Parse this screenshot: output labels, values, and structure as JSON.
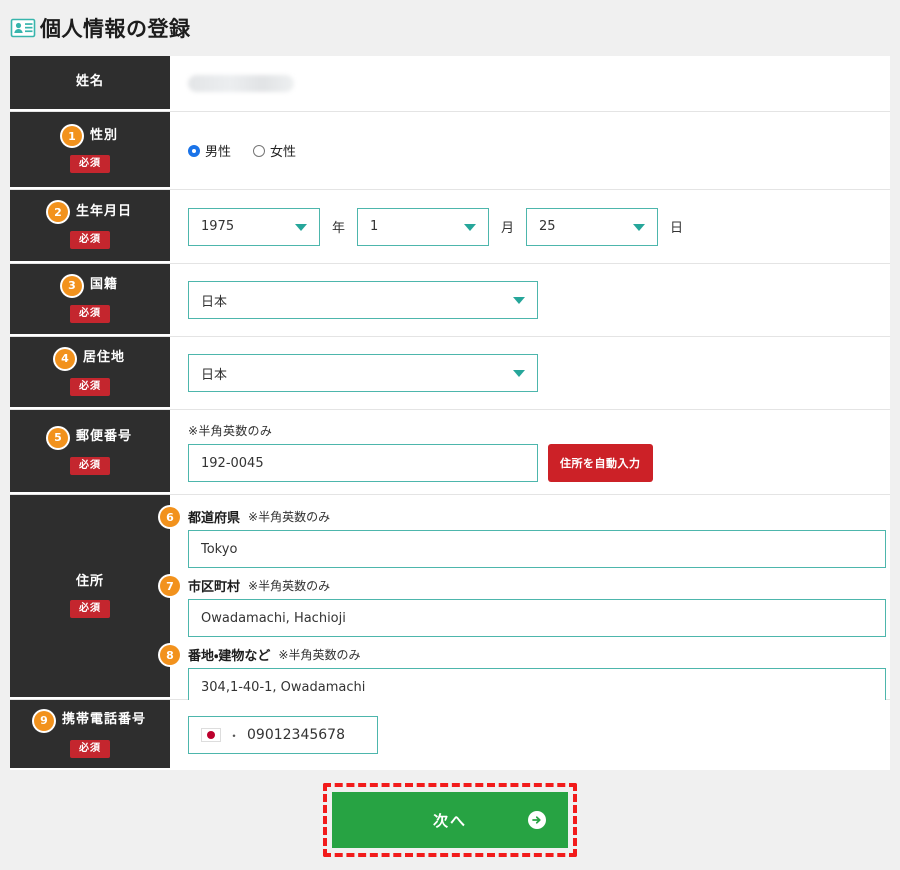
{
  "header": {
    "title": "個人情報の登録",
    "icon": "id-card-icon"
  },
  "form": {
    "rows": {
      "name": {
        "label": "姓名",
        "value_redacted": true
      },
      "gender": {
        "number": "1",
        "label": "性別",
        "required_badge": "必須",
        "options": [
          {
            "label": "男性",
            "selected": true
          },
          {
            "label": "女性",
            "selected": false
          }
        ]
      },
      "birthdate": {
        "number": "2",
        "label": "生年月日",
        "required_badge": "必須",
        "year": "1975",
        "year_unit": "年",
        "month": "1",
        "month_unit": "月",
        "day": "25",
        "day_unit": "日"
      },
      "nationality": {
        "number": "3",
        "label": "国籍",
        "required_badge": "必須",
        "value": "日本"
      },
      "residence": {
        "number": "4",
        "label": "居住地",
        "required_badge": "必須",
        "value": "日本"
      },
      "postal": {
        "number": "5",
        "label": "郵便番号",
        "required_badge": "必須",
        "hint": "※半角英数のみ",
        "value": "192-0045",
        "autofill_button": "住所を自動入力"
      },
      "address": {
        "label": "住所",
        "required_badge": "必須",
        "items": [
          {
            "number": "6",
            "name": "都道府県",
            "hint": "※半角英数のみ",
            "value": "Tokyo"
          },
          {
            "number": "7",
            "name": "市区町村",
            "hint": "※半角英数のみ",
            "value": "Owadamachi, Hachioji"
          },
          {
            "number": "8",
            "name": "番地・建物など",
            "hint": "※半角英数のみ",
            "value": "304,1-40-1, Owadamachi"
          }
        ]
      },
      "mobile": {
        "number": "9",
        "label": "携帯電話番号",
        "required_badge": "必須",
        "country_flag": "japan-flag-icon",
        "separator": "・",
        "value": "09012345678"
      }
    }
  },
  "footer": {
    "next_label": "次へ",
    "next_icon": "arrow-right-circle-icon",
    "highlight_color": "#f21b1b"
  },
  "colors": {
    "label_bg": "#2e2e2e",
    "required_badge": "#c4262e",
    "number_badge": "#f2921d",
    "input_border": "#4db6ac",
    "autofill_button": "#cc2127",
    "next_button": "#27a343",
    "page_bg": "#f0f0f0"
  }
}
